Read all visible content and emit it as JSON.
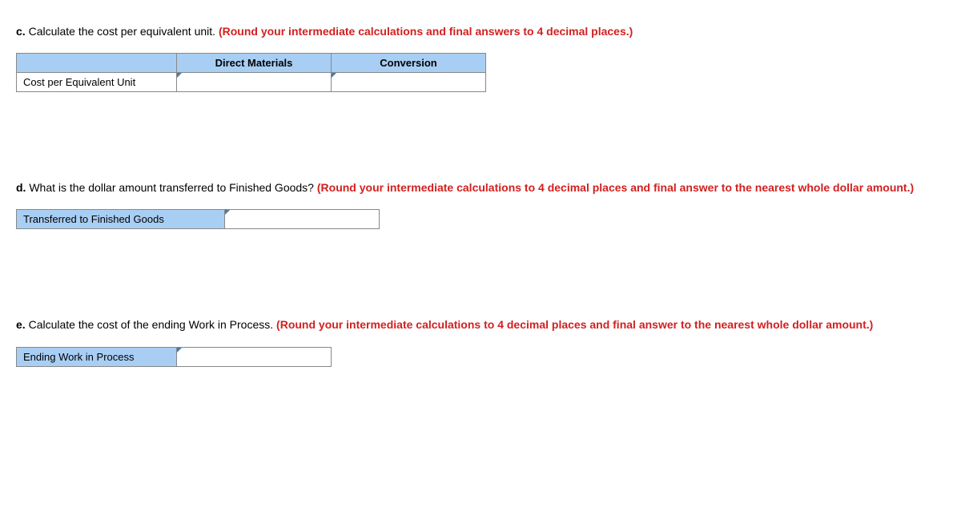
{
  "question_c": {
    "label": "c.",
    "text": "Calculate the cost per equivalent unit.",
    "instruction": "(Round your intermediate calculations and final answers to 4 decimal places.)",
    "headers": {
      "col1": "Direct Materials",
      "col2": "Conversion"
    },
    "row_label": "Cost per Equivalent Unit",
    "values": {
      "direct_materials": "",
      "conversion": ""
    }
  },
  "question_d": {
    "label": "d.",
    "text": "What is the dollar amount transferred to Finished Goods?",
    "instruction": "(Round your intermediate calculations to 4 decimal places and final answer to the nearest whole dollar amount.)",
    "row_label": "Transferred to Finished Goods",
    "value": ""
  },
  "question_e": {
    "label": "e.",
    "text": "Calculate the cost of the ending Work in Process.",
    "instruction": "(Round your intermediate calculations to 4 decimal places and final answer to the nearest whole dollar amount.)",
    "row_label": "Ending Work in Process",
    "value": ""
  }
}
